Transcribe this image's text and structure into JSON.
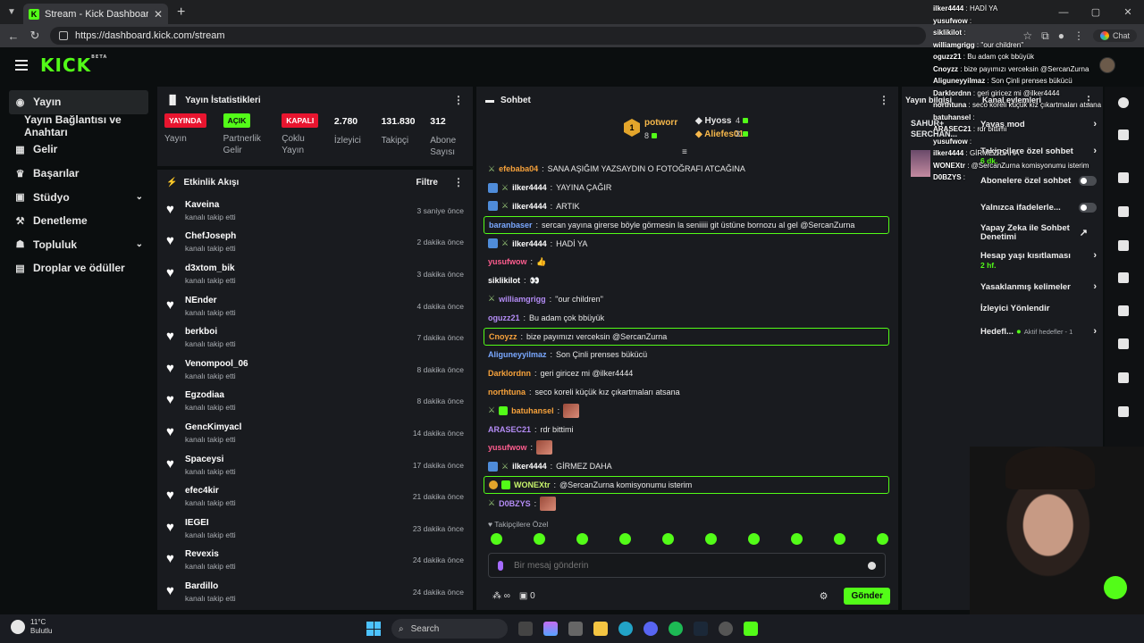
{
  "browser": {
    "tab_title": "Stream - Kick Dashboard",
    "url": "https://dashboard.kick.com/stream",
    "chat_button": "Chat"
  },
  "header": {
    "logo": "KICK",
    "logo_sup": "BETA"
  },
  "sidebar": {
    "items": [
      {
        "label": "Yayın",
        "icon": "broadcast-icon"
      },
      {
        "label": "Yayın Bağlantısı ve Anahtarı",
        "icon": ""
      },
      {
        "label": "Gelir",
        "icon": "revenue-icon"
      },
      {
        "label": "Başarılar",
        "icon": "trophy-icon"
      },
      {
        "label": "Stüdyo",
        "icon": "studio-icon"
      },
      {
        "label": "Denetleme",
        "icon": "hammer-icon"
      },
      {
        "label": "Topluluk",
        "icon": "community-icon"
      },
      {
        "label": "Droplar ve ödüller",
        "icon": "gift-icon"
      }
    ]
  },
  "stats": {
    "title": "Yayın İstatistikleri",
    "items": [
      {
        "badge": "YAYINDA",
        "label": "Yayın"
      },
      {
        "badge": "AÇIK",
        "label": "Partnerlik Gelir"
      },
      {
        "badge": "KAPALI",
        "label": "Çoklu Yayın"
      },
      {
        "value": "2.780",
        "label": "İzleyici"
      },
      {
        "value": "131.830",
        "label": "Takipçi"
      },
      {
        "value": "312",
        "label": "Abone Sayısı"
      }
    ]
  },
  "activity": {
    "title": "Etkinlik Akışı",
    "filter": "Filtre",
    "items": [
      {
        "name": "Kaveina",
        "sub": "kanalı takip etti",
        "time": "3 saniye önce"
      },
      {
        "name": "ChefJoseph",
        "sub": "kanalı takip etti",
        "time": "2 dakika önce"
      },
      {
        "name": "d3xtom_bik",
        "sub": "kanalı takip etti",
        "time": "3 dakika önce"
      },
      {
        "name": "NEnder",
        "sub": "kanalı takip etti",
        "time": "4 dakika önce"
      },
      {
        "name": "berkboi",
        "sub": "kanalı takip etti",
        "time": "7 dakika önce"
      },
      {
        "name": "Venompool_06",
        "sub": "kanalı takip etti",
        "time": "8 dakika önce"
      },
      {
        "name": "Egzodiaa",
        "sub": "kanalı takip etti",
        "time": "8 dakika önce"
      },
      {
        "name": "GencKimyacl",
        "sub": "kanalı takip etti",
        "time": "14 dakika önce"
      },
      {
        "name": "Spaceysi",
        "sub": "kanalı takip etti",
        "time": "17 dakika önce"
      },
      {
        "name": "efec4kir",
        "sub": "kanalı takip etti",
        "time": "21 dakika önce"
      },
      {
        "name": "IEGEI",
        "sub": "kanalı takip etti",
        "time": "23 dakika önce"
      },
      {
        "name": "Revexis",
        "sub": "kanalı takip etti",
        "time": "24 dakika önce"
      },
      {
        "name": "Bardillo",
        "sub": "kanalı takip etti",
        "time": "24 dakika önce"
      }
    ]
  },
  "chat": {
    "title": "Sohbet",
    "pinned": {
      "rank": "1",
      "user1": "potworr",
      "n1": "8",
      "user2": "Hyoss",
      "n2": "4",
      "user3": "Aliefes01",
      "n3": "3"
    },
    "messages": [
      {
        "user": "efebaba04",
        "text": "SANA AŞIĞIM YAZSAYDIN O FOTOĞRAFI ATCAĞINA",
        "color": "c-orange",
        "badges": [
          "s"
        ],
        "hl": false
      },
      {
        "user": "ilker4444",
        "text": "YAYINA ÇAĞIR",
        "color": "c-white",
        "badges": [
          "b",
          "s"
        ],
        "hl": false
      },
      {
        "user": "ilker4444",
        "text": "ARTIK",
        "color": "c-white",
        "badges": [
          "b",
          "s"
        ],
        "hl": false
      },
      {
        "user": "baranbaser",
        "text": "sercan yayına girerse böyle görmesin la seniiiii git üstüne bornozu al gel @SercanZurna",
        "color": "c-blue",
        "badges": [],
        "hl": true
      },
      {
        "user": "ilker4444",
        "text": "HADİ YA",
        "color": "c-white",
        "badges": [
          "b",
          "s"
        ],
        "hl": false
      },
      {
        "user": "yusufwow",
        "text": "👍",
        "color": "c-red",
        "badges": [],
        "hl": false
      },
      {
        "user": "siklikilot",
        "text": "👀",
        "color": "c-white",
        "badges": [],
        "hl": false
      },
      {
        "user": "williamgrigg",
        "text": "''our children''",
        "color": "c-purple",
        "badges": [
          "s"
        ],
        "hl": false
      },
      {
        "user": "oguzz21",
        "text": "Bu adam çok bbüyük",
        "color": "c-purple",
        "badges": [],
        "hl": false
      },
      {
        "user": "Cnoyzz",
        "text": "bize payımızı verceksin @SercanZurna",
        "color": "c-orange",
        "badges": [],
        "hl": true
      },
      {
        "user": "Aliguneyyilmaz",
        "text": "Son Çinli prenses bükücü",
        "color": "c-blue",
        "badges": [],
        "hl": false
      },
      {
        "user": "Darklordnn",
        "text": "geri giricez mi @ilker4444",
        "color": "c-orange",
        "badges": [],
        "hl": false
      },
      {
        "user": "northtuna",
        "text": "seco koreli küçük kız çıkartmaları atsana",
        "color": "c-orange",
        "badges": [],
        "hl": false
      },
      {
        "user": "batuhansel",
        "text": "",
        "color": "c-orange",
        "badges": [
          "s",
          "g"
        ],
        "hl": false,
        "emote": true
      },
      {
        "user": "ARASEC21",
        "text": "rdr bittimi",
        "color": "c-purple",
        "badges": [],
        "hl": false
      },
      {
        "user": "yusufwow",
        "text": "",
        "color": "c-red",
        "badges": [],
        "hl": false,
        "emote": true
      },
      {
        "user": "ilker4444",
        "text": "GİRMEZ DAHA",
        "color": "c-white",
        "badges": [
          "b",
          "s"
        ],
        "hl": false
      },
      {
        "user": "WONEXtr",
        "text": "@SercanZurna komisyonumu isterim",
        "color": "c-lime",
        "badges": [
          "y",
          "g"
        ],
        "hl": true
      },
      {
        "user": "D0BZYS",
        "text": "",
        "color": "c-purple",
        "badges": [
          "s"
        ],
        "hl": false,
        "emote": true
      }
    ],
    "followers_only": "Takipçilere Özel",
    "input_placeholder": "Bir mesaj gönderin",
    "points": "0",
    "send": "Gönder"
  },
  "info": {
    "title": "Yayın bilgisi",
    "stream_title": "SAHUR+ SERCHAN..."
  },
  "settings": {
    "title": "Kanal eylemleri",
    "items": [
      {
        "label": "Yavaş mod"
      },
      {
        "label": "Takipçilere özel sohbet",
        "sub": "6 dk."
      },
      {
        "label": "Abonelere özel sohbet"
      },
      {
        "label": "Yalnızca ifadelerle..."
      },
      {
        "label": "Yapay Zeka ile Sohbet Denetimi"
      },
      {
        "label": "Hesap yaşı kısıtlaması",
        "sub": "2 hf."
      },
      {
        "label": "Yasaklanmış kelimeler"
      },
      {
        "label": "İzleyici Yönlendir"
      },
      {
        "label": "Hedefl...",
        "sub": "Aktif hedefler - 1"
      }
    ]
  },
  "overlay": [
    {
      "user": "ilker4444",
      "text": "HADİ YA"
    },
    {
      "user": "yusufwow",
      "text": ""
    },
    {
      "user": "siklikilot",
      "text": ""
    },
    {
      "user": "williamgrigg",
      "text": "''our children''"
    },
    {
      "user": "oguzz21",
      "text": "Bu adam çok bbüyük"
    },
    {
      "user": "Cnoyzz",
      "text": "bize payımızı verceksin @SercanZurna"
    },
    {
      "user": "Aliguneyyilmaz",
      "text": "Son Çinli prenses bükücü"
    },
    {
      "user": "Darklordnn",
      "text": "geri giricez mi @ilker4444"
    },
    {
      "user": "northtuna",
      "text": "seco koreli küçük kız çıkartmaları atsana"
    },
    {
      "user": "batuhansel",
      "text": ""
    },
    {
      "user": "ARASEC21",
      "text": "rdr bittimi"
    },
    {
      "user": "yusufwow",
      "text": ""
    },
    {
      "user": "ilker4444",
      "text": "GİRMEZ DAHA"
    },
    {
      "user": "WONEXtr",
      "text": "@SercanZurna komisyonumu isterim"
    },
    {
      "user": "D0BZYS",
      "text": ""
    }
  ],
  "taskbar": {
    "temp": "11°C",
    "cond": "Bulutlu",
    "search": "Search"
  },
  "colors": {
    "accent": "#53fc18",
    "live": "#e8152f",
    "panel": "#191b1f",
    "background": "#0b0e0f"
  }
}
